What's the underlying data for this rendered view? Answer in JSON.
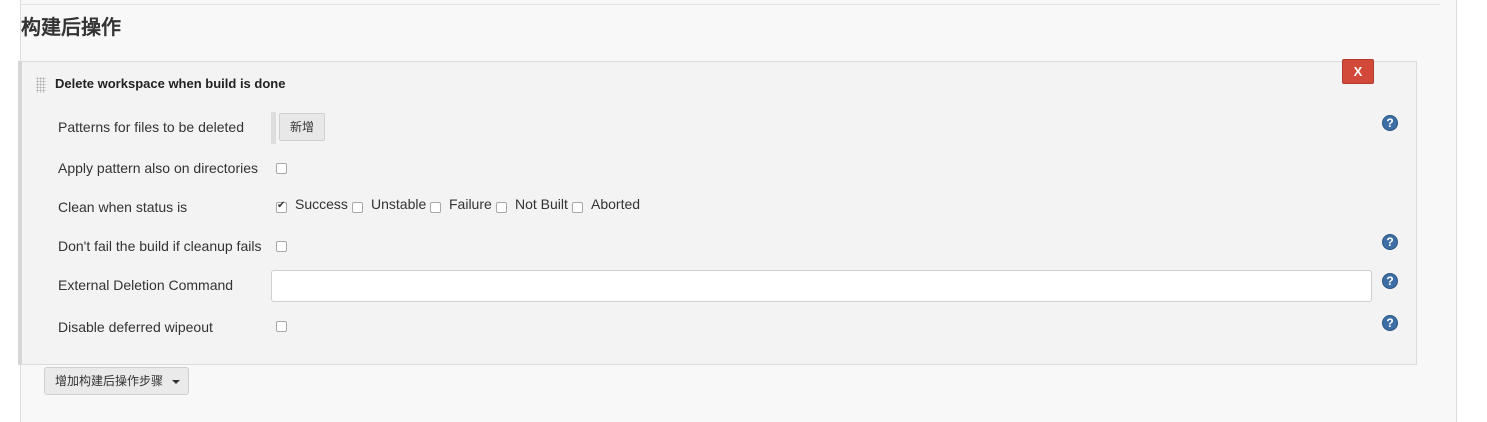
{
  "section": {
    "title": "构建后操作"
  },
  "step": {
    "title": "Delete workspace when build is done",
    "delete_label": "X",
    "patterns": {
      "label": "Patterns for files to be deleted",
      "add_button": "新增"
    },
    "apply_dirs": {
      "label": "Apply pattern also on directories",
      "checked": false
    },
    "clean_status": {
      "label": "Clean when status is",
      "options": [
        {
          "label": "Success",
          "checked": true
        },
        {
          "label": "Unstable",
          "checked": false
        },
        {
          "label": "Failure",
          "checked": false
        },
        {
          "label": "Not Built",
          "checked": false
        },
        {
          "label": "Aborted",
          "checked": false
        }
      ]
    },
    "dont_fail": {
      "label": "Don't fail the build if cleanup fails",
      "checked": false
    },
    "external_cmd": {
      "label": "External Deletion Command",
      "value": ""
    },
    "disable_deferred": {
      "label": "Disable deferred wipeout",
      "checked": false
    },
    "help_glyph": "?"
  },
  "add_post_step": {
    "label": "增加构建后操作步骤"
  },
  "colors": {
    "delete_red": "#d24939",
    "help_blue": "#3d6fa6"
  }
}
